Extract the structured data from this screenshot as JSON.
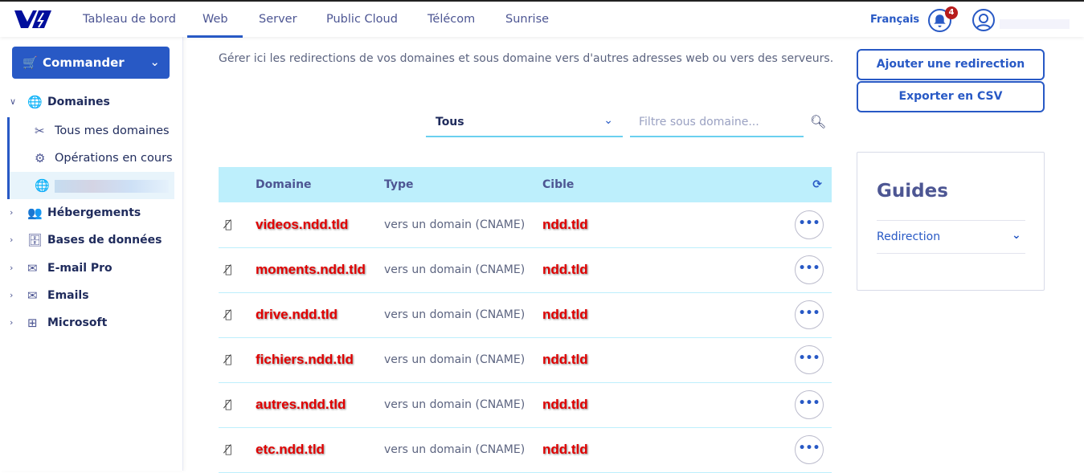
{
  "header": {
    "nav": [
      "Tableau de bord",
      "Web",
      "Server",
      "Public Cloud",
      "Télécom",
      "Sunrise"
    ],
    "active": "Web",
    "language": "Français",
    "notifications": "4"
  },
  "sidebar": {
    "order_button": "Commander",
    "domains": "Domaines",
    "sub_items": [
      "Tous mes domaines",
      "Opérations en cours"
    ],
    "sections": [
      "Hébergements",
      "Bases de données",
      "E-mail Pro",
      "Emails",
      "Microsoft"
    ]
  },
  "main": {
    "description": "Gérer ici les redirections de vos domaines et sous domaine vers d'autres adresses web ou vers des serveurs.",
    "filter_select": "Tous",
    "filter_placeholder": "Filtre sous domaine...",
    "columns": [
      "Domaine",
      "Type",
      "Cible"
    ],
    "rows": [
      {
        "domain": "videos.ndd.tld",
        "type": "vers un domain (CNAME)",
        "target": "ndd.tld"
      },
      {
        "domain": "moments.ndd.tld",
        "type": "vers un domain (CNAME)",
        "target": "ndd.tld"
      },
      {
        "domain": "drive.ndd.tld",
        "type": "vers un domain (CNAME)",
        "target": "ndd.tld"
      },
      {
        "domain": "fichiers.ndd.tld",
        "type": "vers un domain (CNAME)",
        "target": "ndd.tld"
      },
      {
        "domain": "autres.ndd.tld",
        "type": "vers un domain (CNAME)",
        "target": "ndd.tld"
      },
      {
        "domain": "etc.ndd.tld",
        "type": "vers un domain (CNAME)",
        "target": "ndd.tld"
      }
    ],
    "action_label": "•••"
  },
  "right": {
    "add_button": "Ajouter une redirection",
    "export_button": "Exporter en CSV",
    "guides_title": "Guides",
    "guides_link": "Redirection"
  }
}
